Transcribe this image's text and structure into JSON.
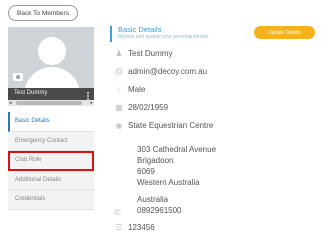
{
  "back_button": {
    "label": "Back To Members"
  },
  "profile": {
    "name_partial": "Test Dummy"
  },
  "sidebar": {
    "items": [
      {
        "label": "Basic Details"
      },
      {
        "label": "Emergency Contact"
      },
      {
        "label": "Club Role"
      },
      {
        "label": "Additional Details"
      },
      {
        "label": "Credentials"
      }
    ]
  },
  "details": {
    "title": "Basic Details",
    "subtitle": "Review and update your personal details",
    "update_button": "Update Details",
    "name": "Test Dummy",
    "email": "admin@decoy.com.au",
    "gender": "Male",
    "dob": "28/02/1959",
    "centre": "State Equestrian Centre",
    "address_line1": "303 Cathedral Avenue",
    "address_line2": "Brigadoon",
    "postcode": "6069",
    "state": "Western Australia",
    "country": "Australia",
    "phone": "0892961500",
    "member_id": "123456"
  },
  "colors": {
    "accent": "#3aa0d8",
    "active_nav": "#2a7ab8",
    "update_button": "#f6b21b",
    "highlight": "#e01010"
  }
}
